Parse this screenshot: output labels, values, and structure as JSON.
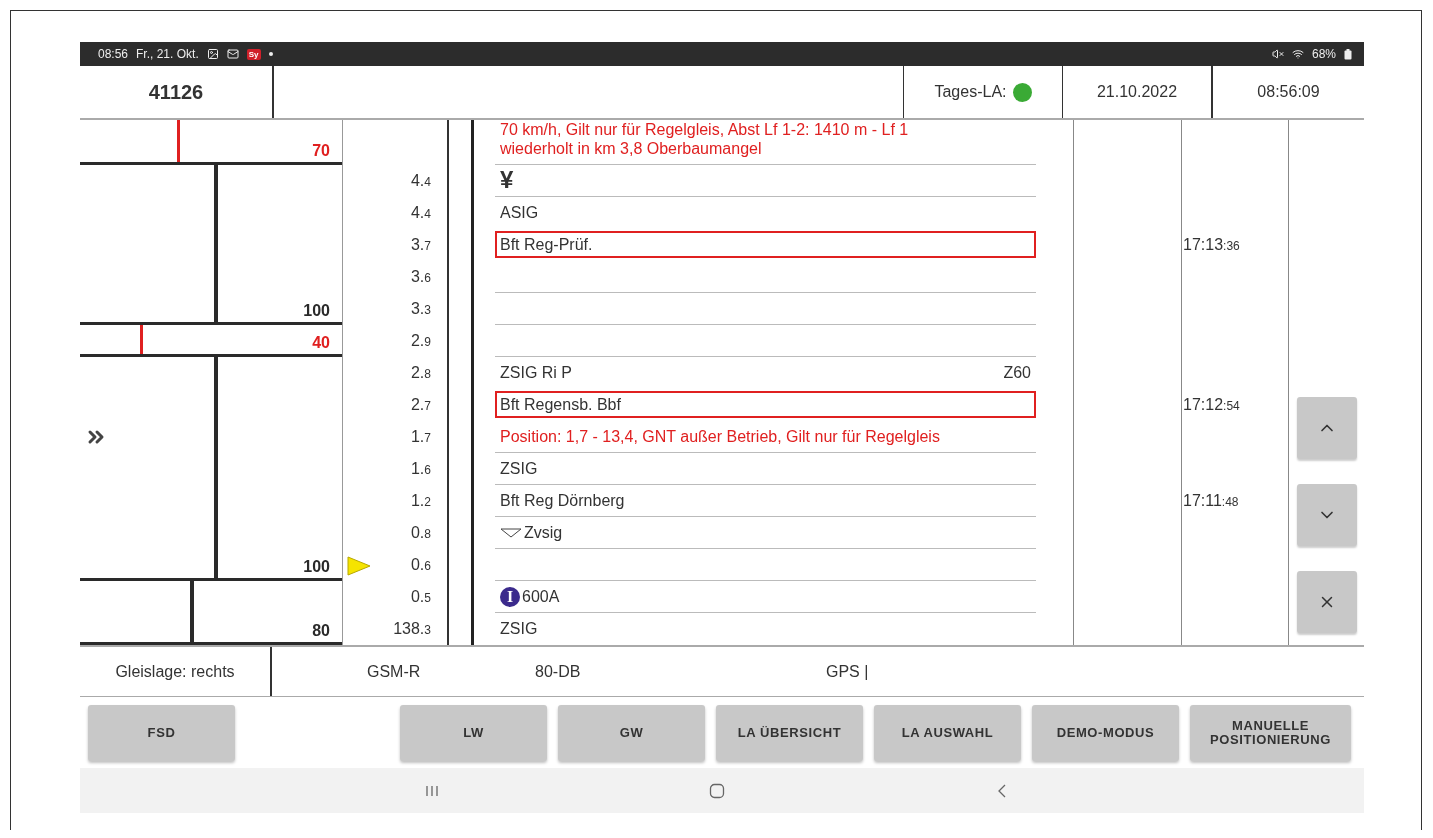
{
  "status_bar": {
    "time": "08:56",
    "date": "Fr., 21. Okt.",
    "app_badge": "Sy",
    "battery": "68%"
  },
  "header": {
    "train_number": "41126",
    "tages_la": {
      "label": "Tages-LA:",
      "color": "#3aaa35"
    },
    "date": "21.10.2022",
    "time": "08:56:09"
  },
  "rows": [
    {
      "kind": "note",
      "text": "70 km/h, Gilt nur für Regelgleis, Abst Lf 1-2: 1410 m - Lf 1 wiederholt in km 3,8 Oberbaumangel",
      "speed": {
        "value": "70",
        "restricted": true,
        "level": 0.37
      }
    },
    {
      "km": {
        "main": "4.",
        "fraction": "4"
      },
      "kind": "symbol",
      "text": "¥",
      "current": false
    },
    {
      "km": {
        "main": "4.",
        "fraction": "4"
      },
      "kind": "text",
      "text": "ASIG",
      "current": false
    },
    {
      "km": {
        "main": "3.",
        "fraction": "7"
      },
      "kind": "station",
      "text": "Bft Reg-Prüf.",
      "time": {
        "main": "17:13",
        "seconds": ":36"
      },
      "current": false
    },
    {
      "km": {
        "main": "3.",
        "fraction": "6"
      },
      "kind": "empty",
      "current": false
    },
    {
      "km": {
        "main": "3.",
        "fraction": "3"
      },
      "kind": "empty",
      "current": false,
      "speed": {
        "value": "100",
        "restricted": false,
        "level": 0.51
      }
    },
    {
      "km": {
        "main": "2.",
        "fraction": "9"
      },
      "kind": "empty",
      "current": false,
      "speed": {
        "value": "40",
        "restricted": true,
        "level": 0.23
      }
    },
    {
      "km": {
        "main": "2.",
        "fraction": "8"
      },
      "kind": "text",
      "text": "ZSIG Ri P",
      "right": "Z60",
      "current": false
    },
    {
      "km": {
        "main": "2.",
        "fraction": "7"
      },
      "kind": "station",
      "text": "Bft Regensb. Bbf",
      "time": {
        "main": "17:12",
        "seconds": ":54"
      },
      "current": false
    },
    {
      "km": {
        "main": "1.",
        "fraction": "7"
      },
      "kind": "note",
      "text": "Position: 1,7 - 13,4, GNT außer Betrieb, Gilt nur für Regelgleis",
      "current": false
    },
    {
      "km": {
        "main": "1.",
        "fraction": "6"
      },
      "kind": "text",
      "text": "ZSIG",
      "current": false
    },
    {
      "km": {
        "main": "1.",
        "fraction": "2"
      },
      "kind": "text",
      "text": "Bft Reg Dörnberg",
      "time": {
        "main": "17:11",
        "seconds": ":48"
      },
      "current": false
    },
    {
      "km": {
        "main": "0.",
        "fraction": "8"
      },
      "kind": "distant-signal",
      "text": "Zvsig",
      "current": false
    },
    {
      "km": {
        "main": "0.",
        "fraction": "6"
      },
      "kind": "empty",
      "current": true,
      "speed": {
        "value": "100",
        "restricted": false,
        "level": 0.51
      }
    },
    {
      "km": {
        "main": "0.",
        "fraction": "5"
      },
      "kind": "info",
      "badge": "I",
      "text": "600A",
      "current": false
    },
    {
      "km": {
        "main": "138.",
        "fraction": "3"
      },
      "kind": "text",
      "text": "ZSIG",
      "current": false,
      "speed": {
        "value": "80",
        "restricted": false,
        "level": 0.42
      }
    }
  ],
  "status_row": {
    "track_position": "Gleislage: rechts",
    "items": [
      "GSM-R",
      "80-DB",
      "GPS |"
    ]
  },
  "buttons": {
    "left": [
      "FSD"
    ],
    "right": [
      "LW",
      "GW",
      "LA ÜBERSICHT",
      "LA AUSWAHL",
      "DEMO-MODUS",
      "MANUELLE POSITIONIERUNG"
    ]
  }
}
